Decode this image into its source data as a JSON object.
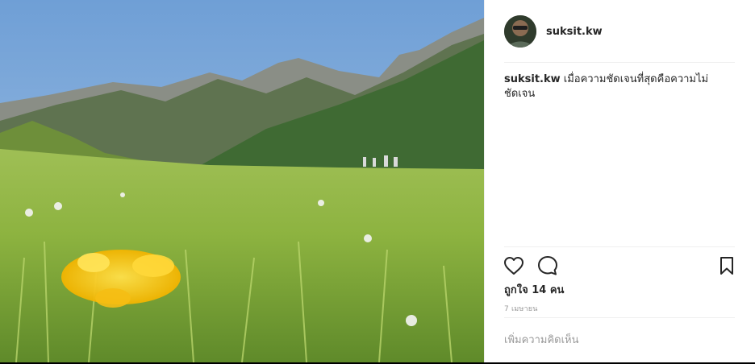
{
  "post": {
    "username": "suksit.kw",
    "caption_user": "suksit.kw",
    "caption_text": "เมื่อความชัดเจนที่สุดคือความไม่ชัดเจน",
    "likes": "ถูกใจ 14 คน",
    "date": "7 เมษายน"
  },
  "comment": {
    "placeholder": "เพิ่มความคิดเห็น"
  },
  "icons": {
    "like": "heart-icon",
    "comment": "comment-icon",
    "save": "bookmark-icon"
  },
  "colors": {
    "text": "#262626",
    "muted": "#999999",
    "divider": "#efefef"
  }
}
